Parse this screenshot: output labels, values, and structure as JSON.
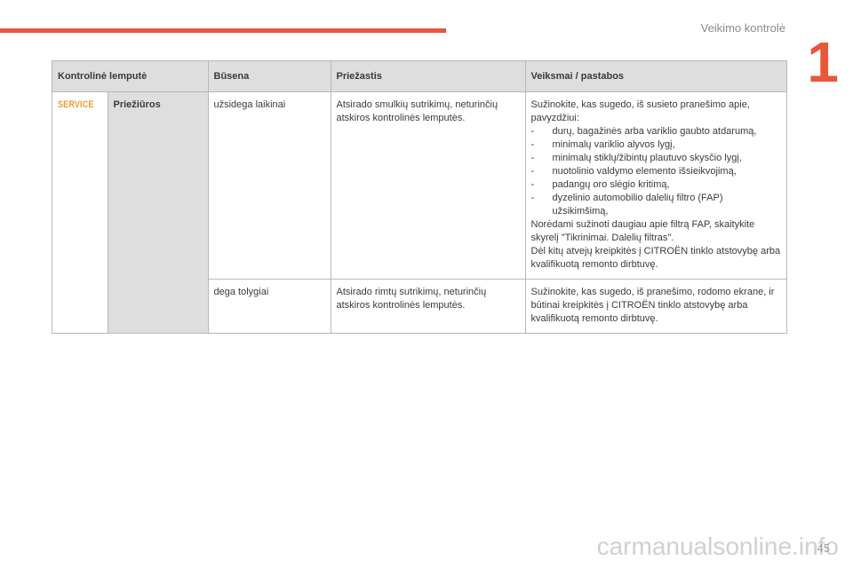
{
  "header": {
    "section_title": "Veikimo kontrolė",
    "chapter_number": "1"
  },
  "table": {
    "headers": [
      "Kontrolinė lemputė",
      "Būsena",
      "Priežastis",
      "Veiksmai / pastabos"
    ],
    "icon_label": "SERVICE",
    "icon": "service-warning-icon",
    "lamp_name": "Priežiūros",
    "rows": [
      {
        "state": "užsidega laikinai",
        "cause": "Atsirado smulkių sutrikimų, neturinčių atskiros kontrolinės lemputės.",
        "action_intro": "Sužinokite, kas sugedo, iš susieto pranešimo apie, pavyzdžiui:",
        "action_items": [
          "durų, bagažinės arba variklio gaubto atdarumą,",
          "minimalų variklio alyvos lygį,",
          "minimalų stiklų/žibintų plautuvo skysčio lygį,",
          "nuotolinio valdymo elemento išsieikvojimą,",
          "padangų oro slėgio kritimą,",
          "dyzelinio automobilio dalelių filtro (FAP) užsikimšimą,"
        ],
        "action_outro1": "Norėdami sužinoti daugiau apie filtrą FAP, skaitykite skyrelį \"Tikrinimai. Dalelių filtras\".",
        "action_outro2": "Dėl kitų atvejų kreipkitės į CITROËN tinklo atstovybę arba kvalifikuotą remonto dirbtuvę."
      },
      {
        "state": "dega tolygiai",
        "cause": "Atsirado rimtų sutrikimų, neturinčių atskiros kontrolinės lemputės.",
        "action": "Sužinokite, kas sugedo, iš pranešimo, rodomo ekrane, ir būtinai kreipkitės į CITROËN tinklo atstovybę arba kvalifikuotą remonto dirbtuvę."
      }
    ]
  },
  "footer": {
    "page_number": "45",
    "watermark": "carmanualsonline.info"
  }
}
